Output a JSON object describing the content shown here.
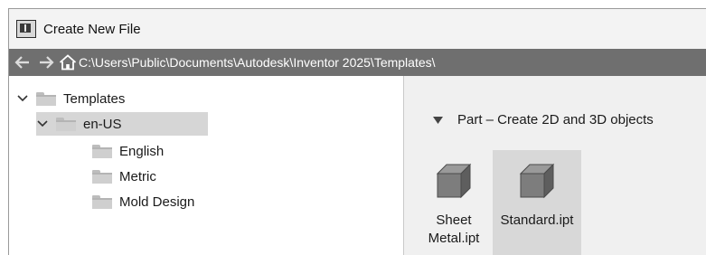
{
  "window": {
    "title": "Create New File",
    "icon": "inventor-app-icon"
  },
  "pathbar": {
    "back_icon": "back-arrow-icon",
    "forward_icon": "forward-arrow-icon",
    "home_icon": "home-icon",
    "path": "C:\\Users\\Public\\Documents\\Autodesk\\Inventor 2025\\Templates\\"
  },
  "tree": {
    "items": [
      {
        "label": "Templates",
        "expanded": true,
        "level": 0
      },
      {
        "label": "en-US",
        "expanded": true,
        "level": 1,
        "selected": true
      },
      {
        "label": "English",
        "level": 2
      },
      {
        "label": "Metric",
        "level": 2
      },
      {
        "label": "Mold Design",
        "level": 2
      }
    ]
  },
  "content": {
    "section_title": "Part – Create 2D and 3D objects",
    "files": [
      {
        "label": "Sheet Metal.ipt",
        "line1": "Sheet",
        "line2": "Metal.ipt",
        "icon": "part-cube-icon",
        "selected": false
      },
      {
        "label": "Standard.ipt",
        "line1": "Standard.ipt",
        "line2": "",
        "icon": "part-cube-icon",
        "selected": true
      }
    ]
  },
  "colors": {
    "pathbar_bg": "#6f6f6f",
    "selection": "#d6d6d6",
    "content_bg": "#f0f0f0"
  }
}
